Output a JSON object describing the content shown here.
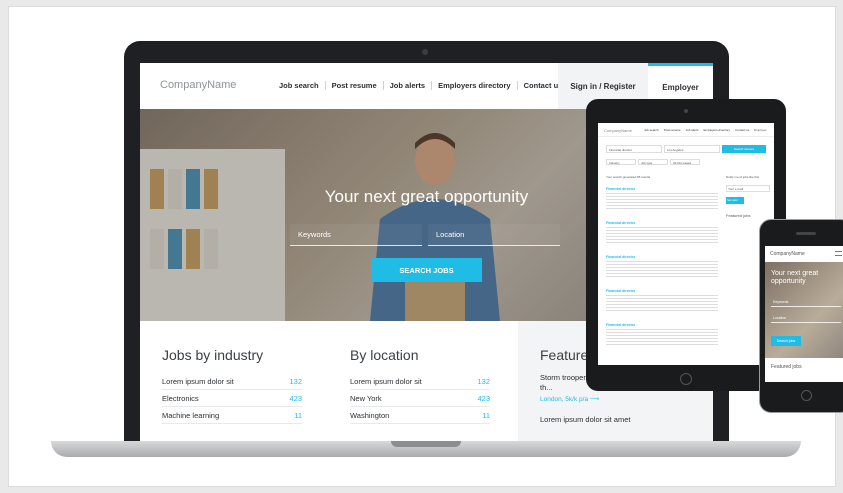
{
  "site": {
    "logo": "CompanyName",
    "nav": [
      "Job search",
      "Post resume",
      "Job alerts",
      "Employers directory",
      "Contact us"
    ],
    "signin": "Sign in / Register",
    "employer": "Employer"
  },
  "hero": {
    "title": "Your next great opportunity",
    "keywords_placeholder": "Keywords",
    "location_placeholder": "Location",
    "search_button": "SEARCH JOBS"
  },
  "industry": {
    "title": "Jobs by industry",
    "rows": [
      {
        "label": "Lorem ipsum dolor sit",
        "count": "132"
      },
      {
        "label": "Electronics",
        "count": "423"
      },
      {
        "label": "Machine learning",
        "count": "11"
      }
    ]
  },
  "location": {
    "title": "By location",
    "rows": [
      {
        "label": "Lorem ipsum dolor sit",
        "count": "132"
      },
      {
        "label": "New York",
        "count": "423"
      },
      {
        "label": "Washington",
        "count": "11"
      }
    ]
  },
  "featured": {
    "title": "Featured",
    "items": [
      {
        "text": "Storm trooper l... description of th...",
        "loc": "London, 5k/k p/a ⟶"
      },
      {
        "text": "Lorem ipsum dolor sit amet",
        "loc": ""
      }
    ]
  },
  "tablet": {
    "logo": "CompanyName",
    "nav": [
      "Job search",
      "Post resume",
      "Job alerts",
      "Employers directory",
      "Contact us"
    ],
    "employer": "Employer",
    "search1": "Financial director",
    "search2": "Los Angeles",
    "button": "Search careers",
    "filters": [
      "Industry",
      "Job type",
      "All this weeks"
    ],
    "results_header": "Your search generated 86 results",
    "result_title": "Financial director",
    "side_title": "Notify me of jobs like this",
    "side_input": "Your e-mail",
    "side_button": "Set alert",
    "side_featured": "Featured jobs"
  },
  "phone": {
    "logo": "CompanyName",
    "hero_title": "Your next great opportunity",
    "input1": "Keywords",
    "input2": "Location",
    "button": "Search jobs",
    "featured": "Featured jobs"
  },
  "colors": {
    "accent": "#1fbde6",
    "laptop": "#1e2023"
  }
}
